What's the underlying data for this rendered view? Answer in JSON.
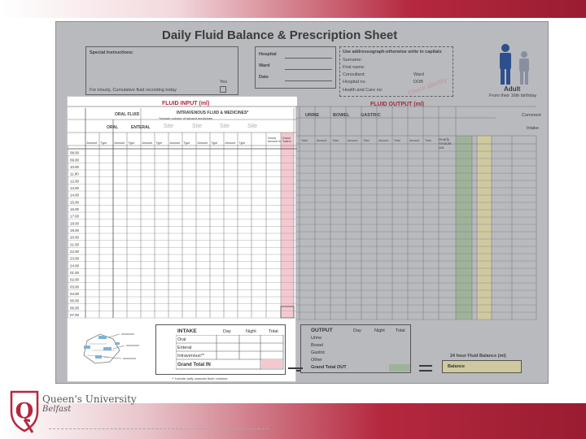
{
  "sheet": {
    "title": "Daily Fluid Balance & Prescription Sheet",
    "special_instructions": "Special Instructions:",
    "hourly_note": "For Hourly, Cumulative fluid recording today",
    "yes_label": "Yes",
    "hospital": "Hospital",
    "ward": "Ward",
    "date": "Date",
    "addressograph": {
      "heading": "Use addressograph-otherwise write in capitals",
      "surname": "Surname:",
      "first_name": "First name:",
      "consultant": "Consultant:",
      "ward": "Ward",
      "hospital_no": "Hospital no.",
      "dob": "DOB",
      "hc_no": "Health and Care no:",
      "stamp": "Check identity"
    },
    "adult_label": "Adult",
    "adult_sub": "From their 16th birthday",
    "fluid_output_title": "FLUID OUTPUT (ml)",
    "output_cols": [
      "URINE",
      "BOWEL",
      "GASTRIC"
    ],
    "comment": "Comment",
    "intake_sub": "Intake",
    "output_sub_cols": [
      "Amount",
      "Total",
      "Amount",
      "Total",
      "Amount",
      "Total",
      "Amount",
      "Total",
      "Amount",
      "Total"
    ],
    "hourly_amount_out": "Hourly Amount out",
    "grand_total_out": "Grand Total out",
    "overall_balance": "Overall Balance",
    "output_summary": {
      "heading": "OUTPUT",
      "cols": [
        "Day",
        "Night",
        "Total"
      ],
      "rows": [
        "Urine",
        "Bowel",
        "Gastric",
        "Other"
      ],
      "total": "Grand Total OUT"
    },
    "balance_box": {
      "heading": "24 hour Fluid Balance (ml)",
      "label": "Balance"
    }
  },
  "inset": {
    "title": "FLUID INPUT (ml)",
    "oral_fluid": "ORAL FLUID",
    "iv_heading": "INTRAVENOUS FLUID & MEDICINES*",
    "iv_sub": "*Include volume of infused medicines",
    "oral": "ORAL",
    "enteral": "ENTERAL",
    "site": "Site",
    "amount": "Amount",
    "type": "Type",
    "hourly_amount_in": "Hourly Amount in",
    "grand_total_in": "Grand Total in",
    "times": [
      "08.00",
      "09.00",
      "10.00",
      "11.00",
      "12.00",
      "13.00",
      "14.00",
      "15.00",
      "16.00",
      "17.00",
      "18.00",
      "19.00",
      "20.00",
      "21.00",
      "22.00",
      "23.00",
      "24.00",
      "01.00",
      "02.00",
      "03.00",
      "04.00",
      "05.00",
      "06.00",
      "07.00"
    ],
    "intake_summary": {
      "heading": "INTAKE",
      "cols": [
        "Day",
        "Night",
        "Total"
      ],
      "rows": [
        "Oral",
        "Enteral",
        "Intravenous**"
      ],
      "total": "Grand Total IN",
      "footnote": "** Include daily cannular flush volumes"
    }
  },
  "logo": {
    "line1": "Queen's University",
    "line2": "Belfast"
  },
  "colors": {
    "brand_red": "#b5283e",
    "pink_column": "#f5c8cf",
    "green_column": "#9fb39a",
    "yellow_column": "#cfc9a0",
    "figure_male": "#2e4f8c"
  }
}
